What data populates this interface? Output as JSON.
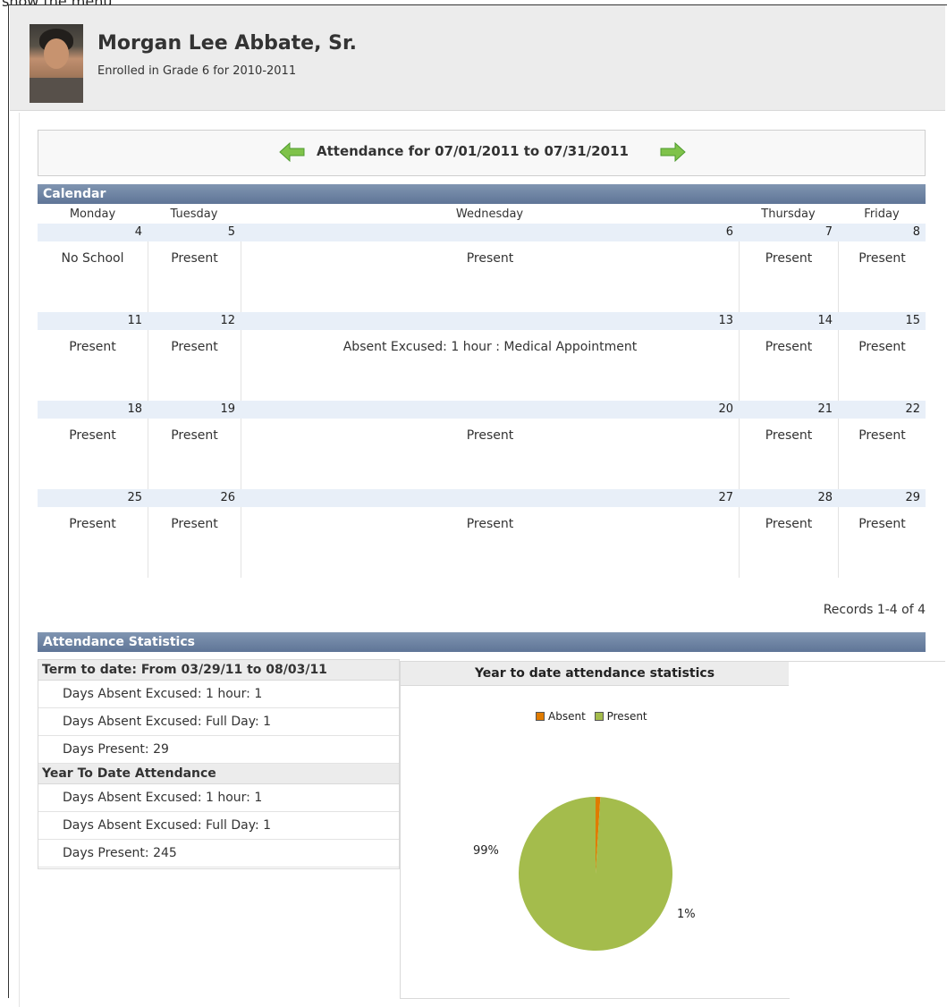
{
  "top_note": "show the menu.",
  "student": {
    "name": "Morgan Lee Abbate, Sr.",
    "enrollment": "Enrolled in Grade 6 for 2010-2011"
  },
  "range": {
    "title": "Attendance for 07/01/2011 to 07/31/2011",
    "prev_icon": "left-arrow-icon",
    "next_icon": "right-arrow-icon"
  },
  "calendar": {
    "section_title": "Calendar",
    "days": [
      "Monday",
      "Tuesday",
      "Wednesday",
      "Thursday",
      "Friday"
    ],
    "weeks": [
      {
        "nums": [
          "4",
          "5",
          "6",
          "7",
          "8"
        ],
        "status": [
          "No School",
          "Present",
          "Present",
          "Present",
          "Present"
        ]
      },
      {
        "nums": [
          "11",
          "12",
          "13",
          "14",
          "15"
        ],
        "status": [
          "Present",
          "Present",
          "Absent Excused: 1 hour : Medical Appointment",
          "Present",
          "Present"
        ]
      },
      {
        "nums": [
          "18",
          "19",
          "20",
          "21",
          "22"
        ],
        "status": [
          "Present",
          "Present",
          "Present",
          "Present",
          "Present"
        ]
      },
      {
        "nums": [
          "25",
          "26",
          "27",
          "28",
          "29"
        ],
        "status": [
          "Present",
          "Present",
          "Present",
          "Present",
          "Present"
        ]
      }
    ],
    "records": "Records 1-4 of 4"
  },
  "statistics": {
    "section_title": "Attendance Statistics",
    "term_heading": "Term to date: From 03/29/11 to 08/03/11",
    "term_items": [
      "Days Absent Excused: 1 hour: 1",
      "Days Absent Excused: Full Day: 1",
      "Days Present: 29"
    ],
    "year_heading": "Year To Date Attendance",
    "year_items": [
      "Days Absent Excused: 1 hour: 1",
      "Days Absent Excused: Full Day: 1",
      "Days Present: 245"
    ]
  },
  "chart_data": {
    "type": "pie",
    "title": "Year to date attendance statistics",
    "legend_position": "top",
    "series": [
      {
        "name": "Absent",
        "value": 1,
        "label": "1%",
        "color": "#e07b00"
      },
      {
        "name": "Present",
        "value": 99,
        "label": "99%",
        "color": "#a4bc4c"
      }
    ]
  }
}
